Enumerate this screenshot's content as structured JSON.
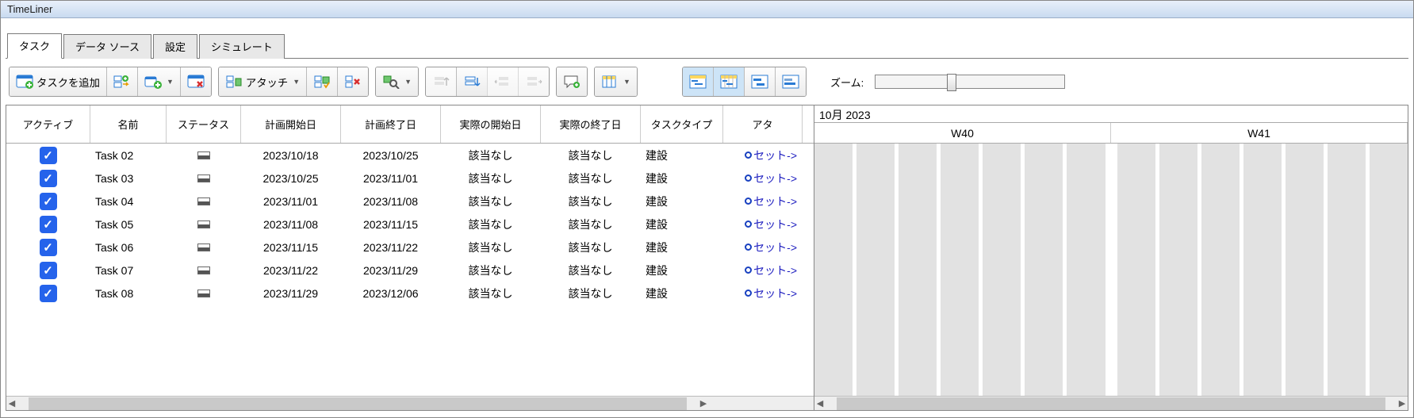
{
  "title": "TimeLiner",
  "tabs": [
    "タスク",
    "データ ソース",
    "設定",
    "シミュレート"
  ],
  "active_tab": 0,
  "toolbar": {
    "add_task": "タスクを追加",
    "attach": "アタッチ",
    "zoom_label": "ズーム:"
  },
  "columns": [
    "アクティブ",
    "名前",
    "ステータス",
    "計画開始日",
    "計画終了日",
    "実際の開始日",
    "実際の終了日",
    "タスクタイプ",
    "アタ"
  ],
  "rows": [
    {
      "active": true,
      "name": "Task 02",
      "plan_start": "2023/10/18",
      "plan_end": "2023/10/25",
      "act_start": "該当なし",
      "act_end": "該当なし",
      "type": "建設",
      "attach": "セット->"
    },
    {
      "active": true,
      "name": "Task 03",
      "plan_start": "2023/10/25",
      "plan_end": "2023/11/01",
      "act_start": "該当なし",
      "act_end": "該当なし",
      "type": "建設",
      "attach": "セット->"
    },
    {
      "active": true,
      "name": "Task 04",
      "plan_start": "2023/11/01",
      "plan_end": "2023/11/08",
      "act_start": "該当なし",
      "act_end": "該当なし",
      "type": "建設",
      "attach": "セット->"
    },
    {
      "active": true,
      "name": "Task 05",
      "plan_start": "2023/11/08",
      "plan_end": "2023/11/15",
      "act_start": "該当なし",
      "act_end": "該当なし",
      "type": "建設",
      "attach": "セット->"
    },
    {
      "active": true,
      "name": "Task 06",
      "plan_start": "2023/11/15",
      "plan_end": "2023/11/22",
      "act_start": "該当なし",
      "act_end": "該当なし",
      "type": "建設",
      "attach": "セット->"
    },
    {
      "active": true,
      "name": "Task 07",
      "plan_start": "2023/11/22",
      "plan_end": "2023/11/29",
      "act_start": "該当なし",
      "act_end": "該当なし",
      "type": "建設",
      "attach": "セット->"
    },
    {
      "active": true,
      "name": "Task 08",
      "plan_start": "2023/11/29",
      "plan_end": "2023/12/06",
      "act_start": "該当なし",
      "act_end": "該当なし",
      "type": "建設",
      "attach": "セット->"
    }
  ],
  "gantt": {
    "month_header": "10月 2023",
    "weeks": [
      "W40",
      "W41"
    ]
  }
}
